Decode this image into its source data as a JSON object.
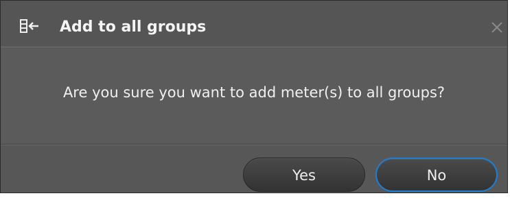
{
  "dialog": {
    "title": "Add to all groups",
    "title_icon": "add-to-groups-icon",
    "close_icon": "close-icon",
    "message": "Are you sure you want to add meter(s) to all groups?",
    "buttons": {
      "yes_label": "Yes",
      "no_label": "No"
    }
  },
  "colors": {
    "background": "#5a5a5a",
    "focus_ring": "#1c7fd4",
    "text": "#ffffff"
  }
}
